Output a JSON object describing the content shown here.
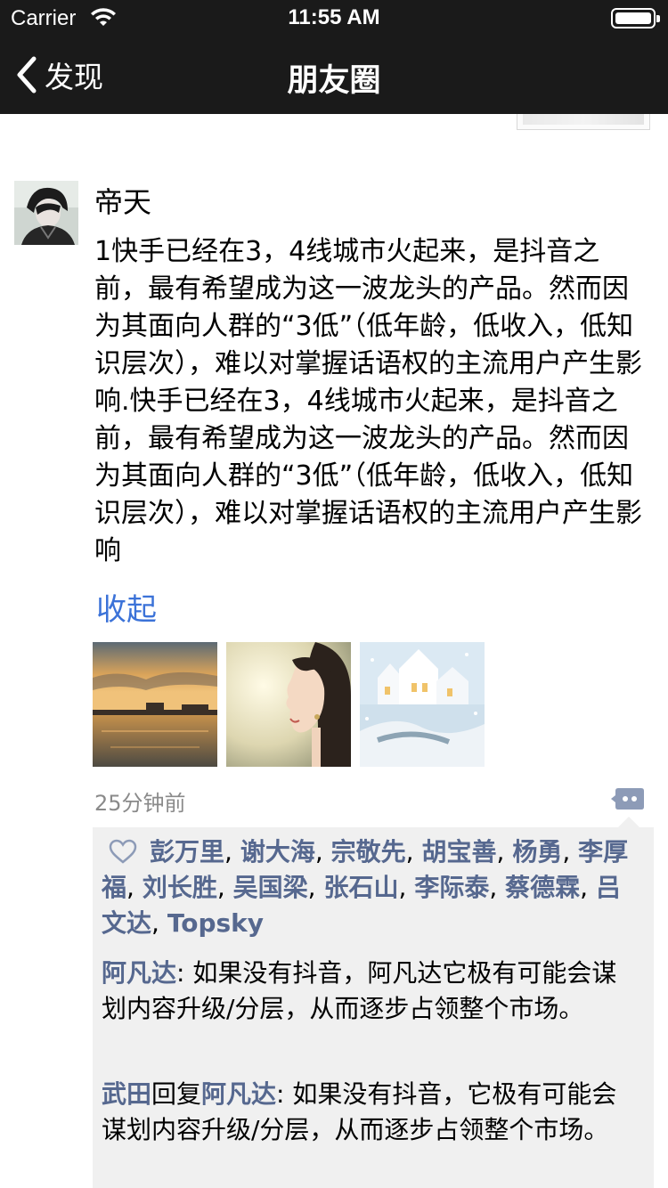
{
  "status_bar": {
    "carrier": "Carrier",
    "time": "11:55 AM"
  },
  "nav": {
    "back_label": "发现",
    "title": "朋友圈"
  },
  "post": {
    "username": "帝天",
    "content": "1快手已经在3，4线城市火起来，是抖音之前，最有希望成为这一波龙头的产品。然而因为其面向人群的“3低”（低年龄，低收入，低知识层次），难以对掌握话语权的主流用户产生影响.快手已经在3，4线城市火起来，是抖音之前，最有希望成为这一波龙头的产品。然而因为其面向人群的“3低”（低年龄，低收入，低知识层次），难以对掌握话语权的主流用户产生影响",
    "collapse_label": "收起",
    "time_ago": "25分钟前",
    "likes": [
      "彭万里",
      "谢大海",
      "宗敬先",
      "胡宝善",
      "杨勇",
      "李厚福",
      "刘长胜",
      "吴国梁",
      "张石山",
      "李际泰",
      "蔡德霖",
      "吕文达",
      "Topsky"
    ],
    "likes_sep": ", ",
    "comments": [
      {
        "author": "阿凡达",
        "reply_word": "",
        "reply_to": "",
        "colon": ": ",
        "text": "如果没有抖音，阿凡达它极有可能会谋划内容升级/分层，从而逐步占领整个市场。"
      },
      {
        "author": "武田",
        "reply_word": "回复",
        "reply_to": "阿凡达",
        "colon": ": ",
        "text": "如果没有抖音，它极有可能会谋划内容升级/分层，从而逐步占领整个市场。"
      }
    ]
  },
  "colors": {
    "nav_bg": "#1a1a1a",
    "link": "#3b72d8",
    "name": "#56688f",
    "panel_bg": "#f0f0f0",
    "meta": "#8a8a8a"
  }
}
